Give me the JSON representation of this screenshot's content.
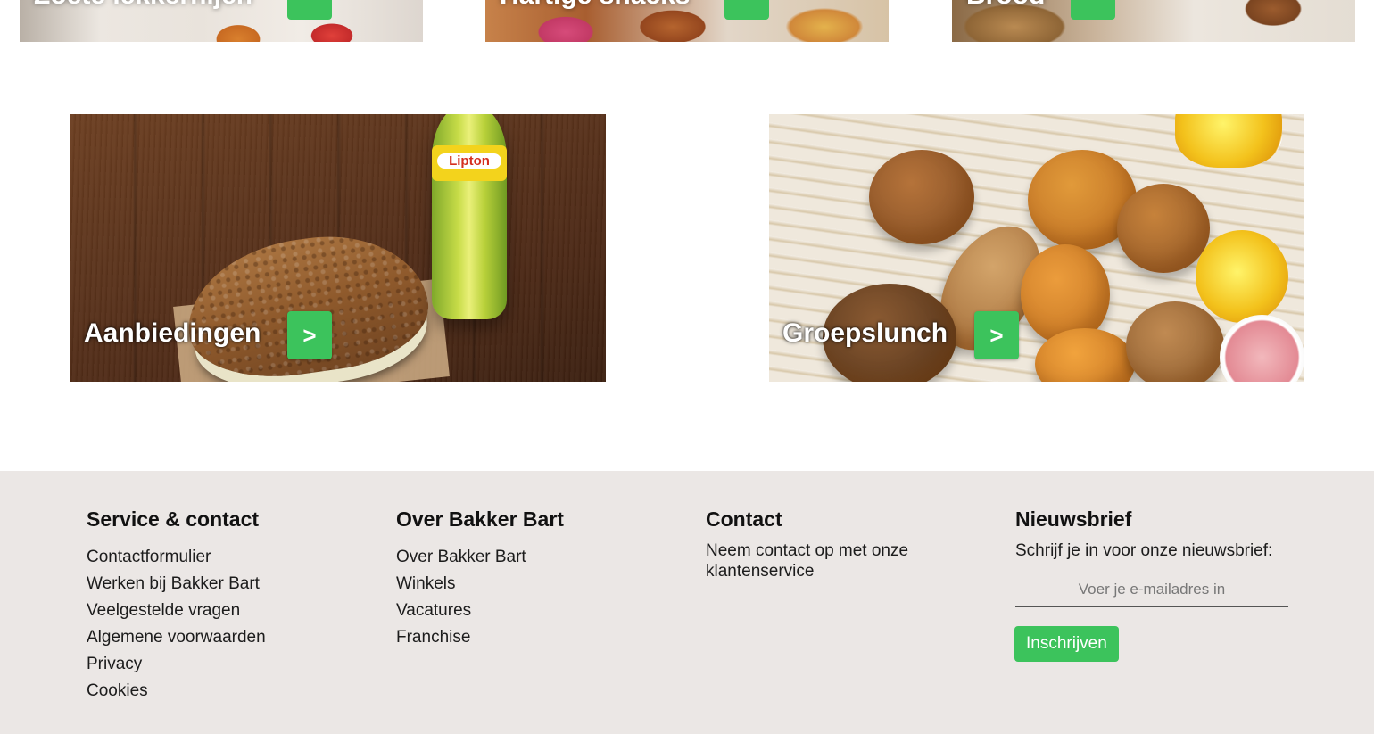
{
  "top_tiles": [
    {
      "label": "Zoete lekkernijen",
      "button": ">"
    },
    {
      "label": "Hartige snacks",
      "button": ">"
    },
    {
      "label": "Brood",
      "button": ">"
    }
  ],
  "promo_tiles": [
    {
      "label": "Aanbiedingen",
      "button": ">",
      "bottle_brand": "Lipton"
    },
    {
      "label": "Groepslunch",
      "button": ">"
    }
  ],
  "footer": {
    "service": {
      "title": "Service & contact",
      "links": [
        "Contactformulier",
        "Werken bij Bakker Bart",
        "Veelgestelde vragen",
        "Algemene voorwaarden",
        "Privacy",
        "Cookies"
      ]
    },
    "over": {
      "title": "Over Bakker Bart",
      "links": [
        "Over Bakker Bart",
        "Winkels",
        "Vacatures",
        "Franchise"
      ]
    },
    "contact": {
      "title": "Contact",
      "text": "Neem contact op met onze klantenservice"
    },
    "newsletter": {
      "title": "Nieuwsbrief",
      "text": "Schrijf je in voor onze nieuwsbrief:",
      "email_placeholder": "Voer je e-mailadres in",
      "email_value": "",
      "button": "Inschrijven"
    }
  },
  "colors": {
    "accent_green": "#3cc35c",
    "footer_bg": "#ebe7e5"
  }
}
